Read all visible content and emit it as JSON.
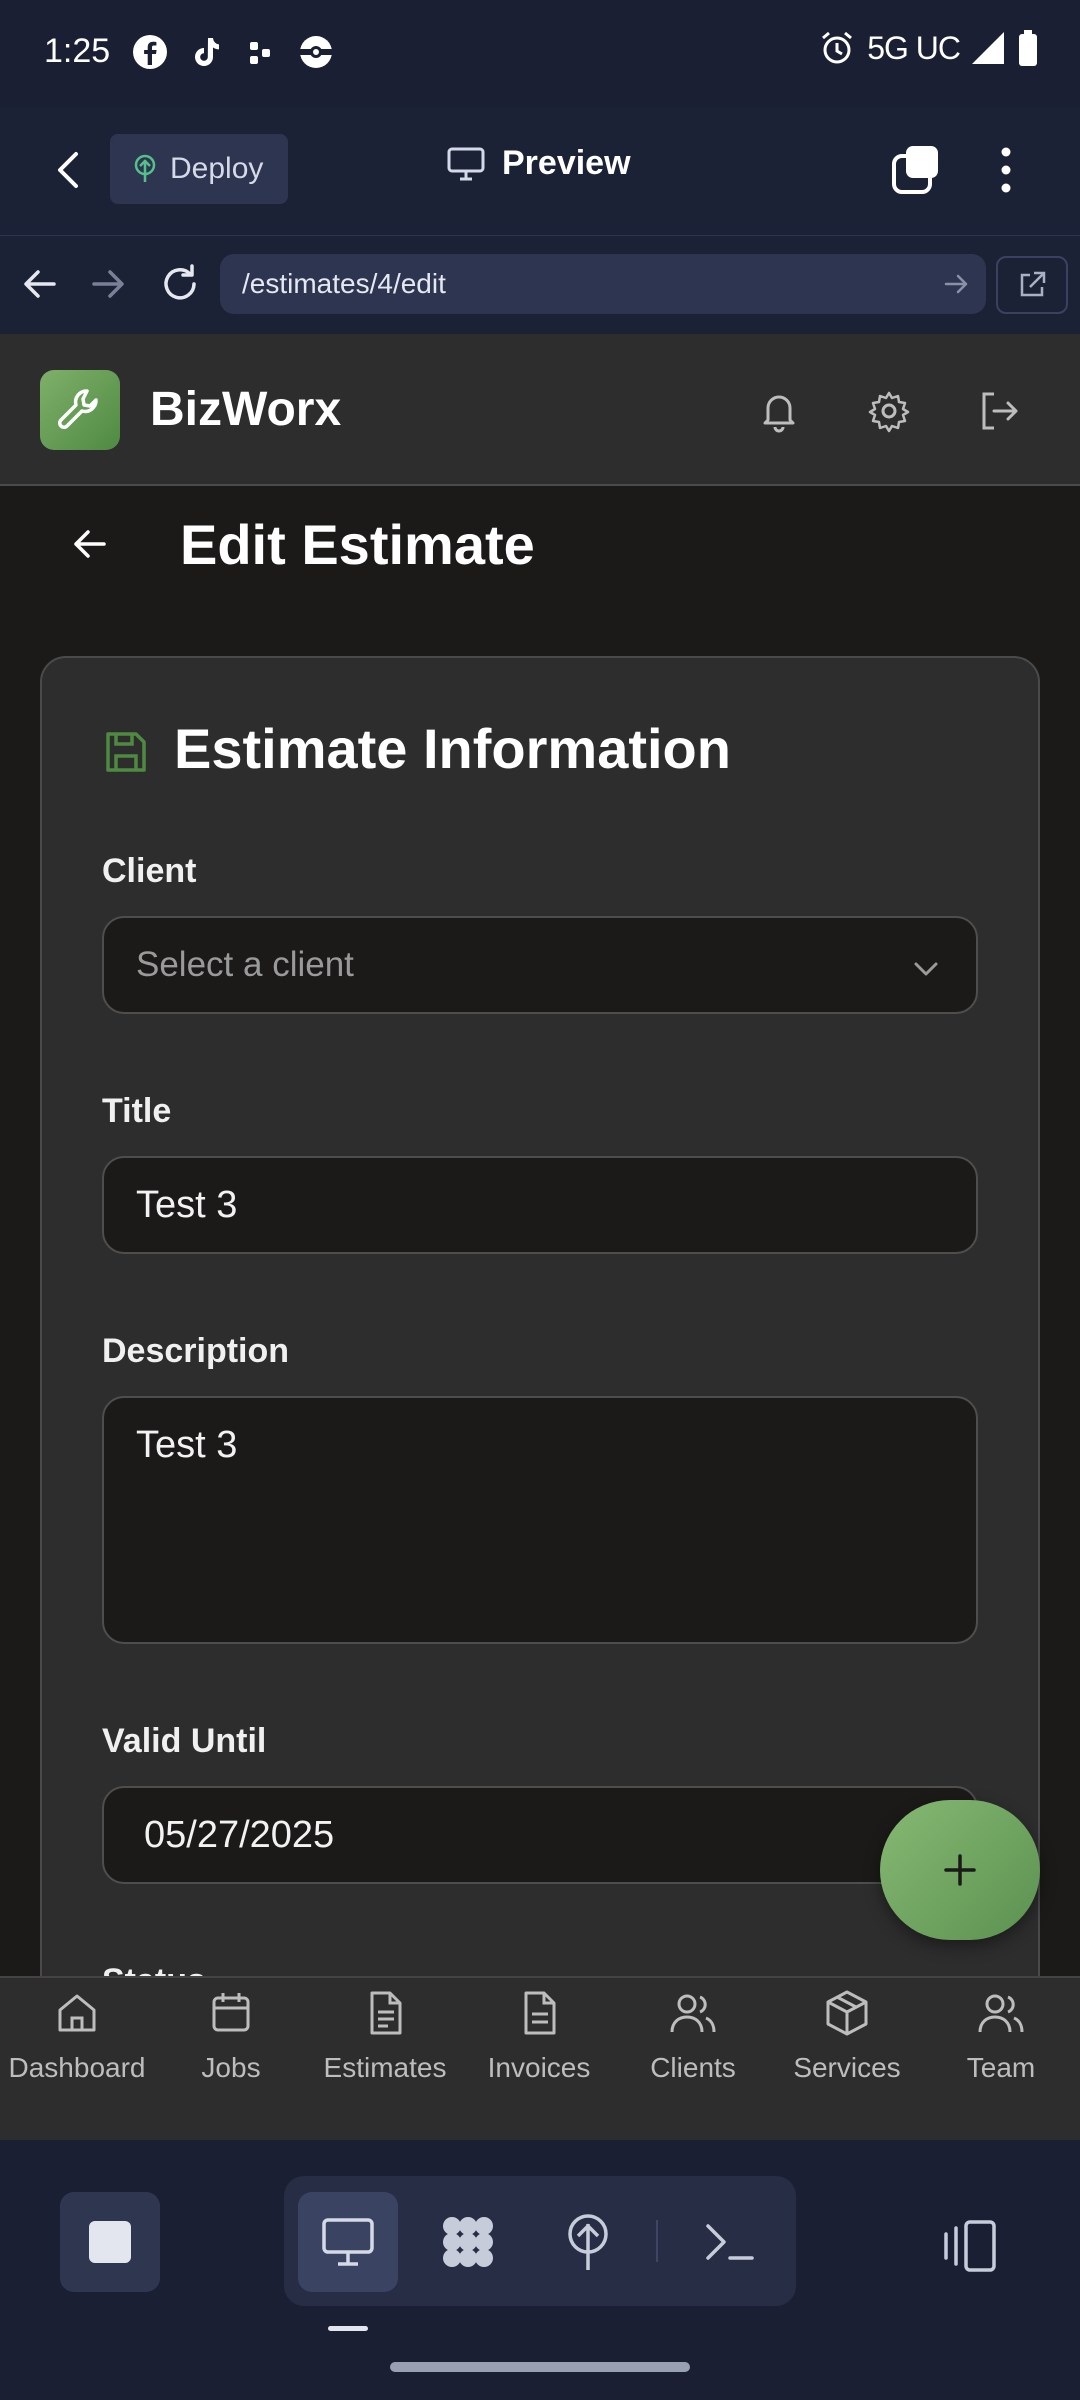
{
  "status_bar": {
    "time": "1:25",
    "network": "5G UC",
    "notification_icons": [
      "facebook-icon",
      "tiktok-icon",
      "dots-icon",
      "pokeball-icon"
    ],
    "right_icons": [
      "alarm-icon",
      "signal-icon",
      "battery-icon"
    ]
  },
  "toolbar": {
    "deploy_label": "Deploy",
    "preview_label": "Preview"
  },
  "browser": {
    "url": "/estimates/4/edit"
  },
  "app": {
    "brand": "BizWorx",
    "page_title": "Edit Estimate",
    "card_title": "Estimate Information",
    "accent_color": "#6aa35a",
    "form": {
      "client_label": "Client",
      "client_placeholder": "Select a client",
      "title_label": "Title",
      "title_value": "Test 3",
      "description_label": "Description",
      "description_value": "Test 3",
      "valid_until_label": "Valid Until",
      "valid_until_value": "05/27/2025",
      "status_label": "Status"
    },
    "fab_label": "+"
  },
  "bottom_nav": [
    {
      "label": "Dashboard",
      "icon": "home-icon"
    },
    {
      "label": "Jobs",
      "icon": "calendar-icon"
    },
    {
      "label": "Estimates",
      "icon": "document-icon"
    },
    {
      "label": "Invoices",
      "icon": "invoice-icon"
    },
    {
      "label": "Clients",
      "icon": "users-icon"
    },
    {
      "label": "Services",
      "icon": "package-icon"
    },
    {
      "label": "Team",
      "icon": "team-icon"
    }
  ]
}
